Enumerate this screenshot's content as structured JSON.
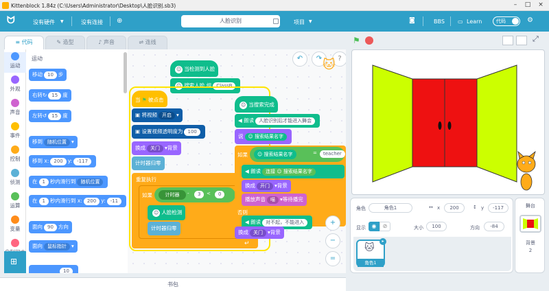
{
  "window": {
    "title": "Kittenblock 1.84z (C:\\Users\\Administrator\\Desktop\\人脸识别.sb3)"
  },
  "menu": {
    "hardware": "没有硬件",
    "connection": "没有连接",
    "project_name": "人脸识别",
    "project_menu": "项目",
    "bbs": "BBS",
    "learn": "Learn",
    "mode": "代码"
  },
  "tabs": [
    {
      "label": "代码"
    },
    {
      "label": "造型"
    },
    {
      "label": "声音"
    },
    {
      "label": "连线"
    }
  ],
  "categories": [
    {
      "label": "运动",
      "color": "#4c97ff"
    },
    {
      "label": "外观",
      "color": "#9966ff"
    },
    {
      "label": "声音",
      "color": "#cf63cf"
    },
    {
      "label": "事件",
      "color": "#ffbf00"
    },
    {
      "label": "控制",
      "color": "#ffab19"
    },
    {
      "label": "侦测",
      "color": "#5cb1d6"
    },
    {
      "label": "运算",
      "color": "#59c059"
    },
    {
      "label": "变量",
      "color": "#ff8c1a"
    },
    {
      "label": "自制积木",
      "color": "#ff6680"
    }
  ],
  "palette": {
    "section": "运动",
    "move": {
      "a": "移动",
      "v": "10",
      "b": "步"
    },
    "turn_right": {
      "a": "右转",
      "v": "15",
      "b": "度"
    },
    "turn_left": {
      "a": "左转",
      "v": "15",
      "b": "度"
    },
    "goto": {
      "a": "移到",
      "dd": "随机位置"
    },
    "goto_xy": {
      "a": "移到 x:",
      "x": "200",
      "b": "y:",
      "y": "-117"
    },
    "glide": {
      "a": "在",
      "v": "1",
      "b": "秒内滑行到",
      "dd": "随机位置"
    },
    "glide_xy": {
      "a": "在",
      "v": "1",
      "b": "秒内滑行到 x:",
      "x": "200",
      "c": "y:",
      "y": "-11"
    },
    "point_dir": {
      "a": "面向",
      "v": "90",
      "b": "方向"
    },
    "point_to": {
      "a": "面向",
      "dd": "鼠标指针"
    },
    "last": "10"
  },
  "scripts": {
    "s1": {
      "hat": "当检测到人脸",
      "b1_a": "搜索人脸 组",
      "b1_v": "ClassB"
    },
    "s2": {
      "hat": "当",
      "hat_b": "被点击",
      "video_a": "将视频",
      "video_dd": "开启",
      "trans_a": "设置视频透明度为",
      "trans_v": "100",
      "costume_a": "换成",
      "costume_dd": "关门",
      "costume_b": "背景",
      "timer_reset": "计时器归零",
      "forever": "重复执行",
      "if_a": "如果",
      "timer": "计时器",
      "minus": "-",
      "three": "3",
      "lt": "<",
      "zero": "0",
      "then": "那么",
      "face_detect": "人脸检测",
      "timer_reset2": "计时器归零"
    },
    "s3": {
      "hat": "当搜索完成",
      "say_a": "朗读",
      "say_v": "人脸识别后才能进入舞会",
      "ask": "说",
      "ask_v": "搜索结果名字",
      "if_a": "如果",
      "name": "搜索结果名字",
      "eq": "=",
      "teacher": "teacher",
      "say2_a": "朗读",
      "say2_b": "连接",
      "say2_v": "搜索结果名字",
      "costume_a": "换成",
      "costume_dd": "开门",
      "costume_b": "背景",
      "sound_a": "播放声音",
      "sound_dd": "喵",
      "sound_b": "等待播完",
      "else": "否则",
      "say3_a": "朗读",
      "say3_v": "对不起，不能进入",
      "costume2_a": "换成",
      "costume2_dd": "关门",
      "costume2_b": "背景"
    }
  },
  "zoom": {
    "in": "+",
    "out": "−",
    "reset": "="
  },
  "sprite": {
    "label_sprite": "角色",
    "name": "角色1",
    "label_x": "x",
    "x": "200",
    "label_y": "y",
    "y": "-117",
    "label_show": "显示",
    "label_size": "大小",
    "size": "100",
    "label_dir": "方向",
    "dir": "-84",
    "thumb_name": "角色1"
  },
  "stage_panel": {
    "title": "舞台",
    "backdrops_label": "背景",
    "backdrops_count": "2"
  },
  "backpack": "书包",
  "colors": {
    "motion": "#4c97ff",
    "looks": "#9966ff",
    "events": "#ffbf00",
    "control": "#ffab19",
    "operators": "#59c059",
    "ext": "#0fbd8c",
    "video": "#0f5ea8",
    "accent": "#2fa0c8",
    "door": "#ee1111",
    "wall": "#ccff00"
  }
}
